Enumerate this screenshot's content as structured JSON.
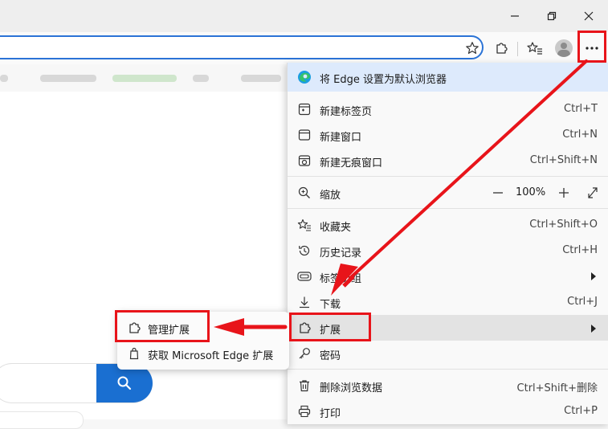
{
  "menu": {
    "set_default": "将 Edge 设置为默认浏览器",
    "items": [
      {
        "label": "新建标签页",
        "shortcut": "Ctrl+T",
        "icon": "new-tab-icon"
      },
      {
        "label": "新建窗口",
        "shortcut": "Ctrl+N",
        "icon": "new-window-icon"
      },
      {
        "label": "新建无痕窗口",
        "shortcut": "Ctrl+Shift+N",
        "icon": "inprivate-icon"
      },
      {
        "label": "缩放",
        "icon": "zoom-icon",
        "zoom_value": "100%"
      },
      {
        "label": "收藏夹",
        "shortcut": "Ctrl+Shift+O",
        "icon": "favorites-icon"
      },
      {
        "label": "历史记录",
        "shortcut": "Ctrl+H",
        "icon": "history-icon"
      },
      {
        "label": "标签页组",
        "icon": "tab-groups-icon"
      },
      {
        "label": "下载",
        "shortcut": "Ctrl+J",
        "icon": "download-icon"
      },
      {
        "label": "扩展",
        "icon": "extensions-icon"
      },
      {
        "label": "密码",
        "icon": "key-icon"
      },
      {
        "label": "删除浏览数据",
        "shortcut": "Ctrl+Shift+删除",
        "icon": "trash-icon"
      },
      {
        "label": "打印",
        "shortcut": "Ctrl+P",
        "icon": "print-icon"
      }
    ]
  },
  "submenu": {
    "manage_extensions": "管理扩展",
    "get_extensions": "获取 Microsoft Edge 扩展"
  },
  "colors": {
    "highlight_red": "#e8141a",
    "accent_blue": "#1a6fd1",
    "banner_blue": "#ddeafc"
  }
}
